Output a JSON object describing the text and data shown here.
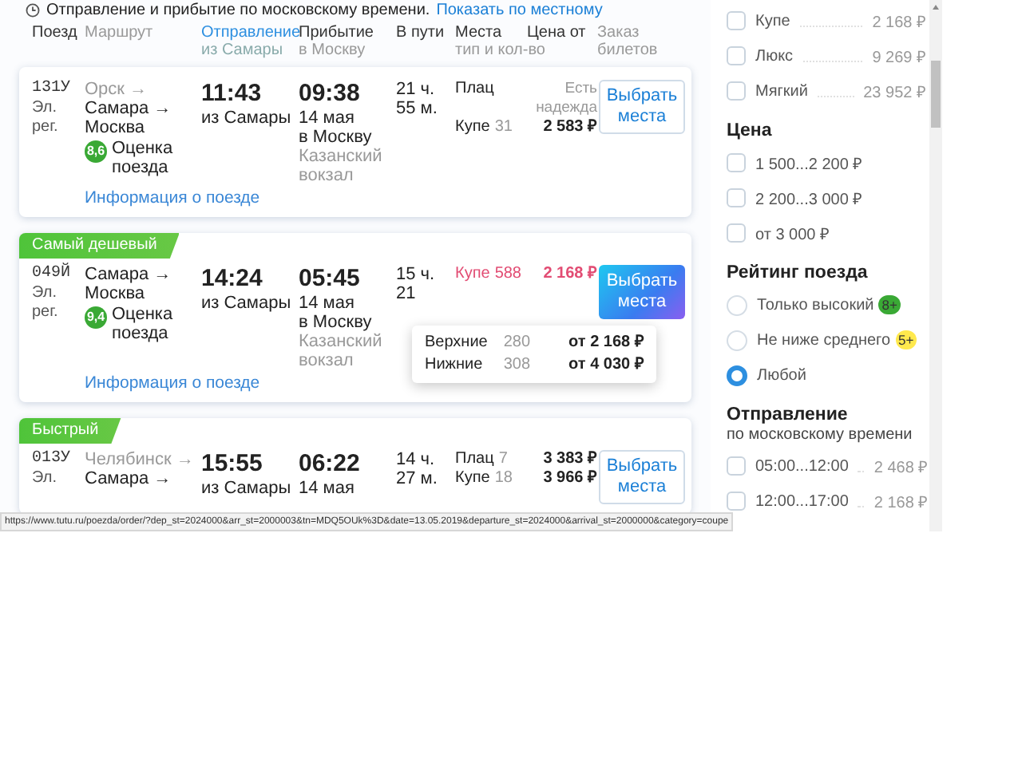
{
  "notice": {
    "text": "Отправление и прибытие по московскому времени.",
    "link": "Показать по местному"
  },
  "columns": [
    {
      "title": "Поезд",
      "kind": "plain"
    },
    {
      "title": "Маршрут",
      "kind": "muted"
    },
    {
      "title": "Отправление",
      "subtitle": "из Самары",
      "kind": "sorted"
    },
    {
      "title": "Прибытие",
      "subtitle": "в Москву",
      "kind": "plain"
    },
    {
      "title": "В пути",
      "kind": "plain"
    },
    {
      "title": "Места",
      "subtitle": "тип и кол-во",
      "kind": "plain"
    },
    {
      "title": "Цена от",
      "kind": "plain"
    },
    {
      "title": "Заказ",
      "subtitle": "билетов",
      "kind": "muted"
    }
  ],
  "trains": [
    {
      "number": "131У",
      "type": [
        "Эл.",
        "рег."
      ],
      "route": [
        {
          "name": "Орск →",
          "muted": true
        },
        {
          "name": "Самара →",
          "muted": false
        },
        {
          "name": "Москва",
          "muted": false
        }
      ],
      "rating": {
        "score": "8,6",
        "label": "Оценка поезда",
        "color": "#3aa935"
      },
      "info_link": "Информация о поезде",
      "departure": {
        "time": "11:43",
        "note": "из Самары"
      },
      "arrival": {
        "time": "09:38",
        "date": "14 мая",
        "city": "в Москву",
        "station": "Казанский вокзал"
      },
      "duration": [
        "21 ч.",
        "55 м."
      ],
      "seats": [
        {
          "type": "Плац",
          "note": "Есть надежда",
          "hovered": false
        },
        {
          "type": "Купе",
          "count": "31",
          "price": "2 583 ₽",
          "hovered": false
        }
      ],
      "button": {
        "label": "Выбрать места",
        "hovered": false
      }
    },
    {
      "tag": "Самый дешевый",
      "number": "049Й",
      "type": [
        "Эл.",
        "рег."
      ],
      "route": [
        {
          "name": "Самара →",
          "muted": false
        },
        {
          "name": "Москва",
          "muted": false
        }
      ],
      "rating": {
        "score": "9,4",
        "label": "Оценка поезда",
        "color": "#3aa935"
      },
      "info_link": "Информация о поезде",
      "departure": {
        "time": "14:24",
        "note": "из Самары"
      },
      "arrival": {
        "time": "05:45",
        "date": "14 мая",
        "city": "в Москву",
        "station": "Казанский вокзал"
      },
      "duration": [
        "15 ч.",
        "21"
      ],
      "seats": [
        {
          "type": "Купе",
          "count": "588",
          "price": "2 168 ₽",
          "hovered": true
        }
      ],
      "button": {
        "label": "Выбрать места",
        "hovered": true
      },
      "popup": [
        {
          "berth": "Верхние",
          "count": "280",
          "price": "от 2 168 ₽"
        },
        {
          "berth": "Нижние",
          "count": "308",
          "price": "от 4 030 ₽"
        }
      ]
    },
    {
      "tag": "Быстрый",
      "number": "013У",
      "type": [
        "Эл."
      ],
      "route": [
        {
          "name": "Челябинск →",
          "muted": true
        },
        {
          "name": "Самара →",
          "muted": false
        }
      ],
      "departure": {
        "time": "15:55",
        "note": "из Самары"
      },
      "arrival": {
        "time": "06:22",
        "date": "14 мая"
      },
      "duration": [
        "14 ч.",
        "27 м."
      ],
      "seats": [
        {
          "type": "Плац",
          "count": "7",
          "price": "3 383 ₽",
          "hovered": false
        },
        {
          "type": "Купе",
          "count": "18",
          "price": "3 966 ₽",
          "hovered": false
        }
      ],
      "button": {
        "label": "Выбрать места",
        "hovered": false
      }
    }
  ],
  "filters": [
    {
      "kind": "checkbox",
      "items": [
        {
          "label": "Купе",
          "price": "2 168 ₽",
          "checked": false
        },
        {
          "label": "Люкс",
          "price": "9 269 ₽",
          "checked": false
        },
        {
          "label": "Мягкий",
          "price": "23 952 ₽",
          "checked": false
        }
      ]
    },
    {
      "kind": "checkbox",
      "title": "Цена",
      "items": [
        {
          "label": "1 500...2 200 ₽",
          "checked": false
        },
        {
          "label": "2 200...3 000 ₽",
          "checked": false
        },
        {
          "label": "от 3 000 ₽",
          "checked": false
        }
      ]
    },
    {
      "kind": "radio",
      "title": "Рейтинг поезда",
      "items": [
        {
          "label": "Только высокий",
          "badge": "8+",
          "color": "#3aa935",
          "selected": false
        },
        {
          "label": "Не ниже среднего",
          "badge": "5+",
          "color": "#ffe94d",
          "selected": false
        },
        {
          "label": "Любой",
          "selected": true
        }
      ]
    },
    {
      "kind": "checkbox",
      "title": "Отправление",
      "subtitle": "по московскому времени",
      "items": [
        {
          "label": "05:00...12:00",
          "price": "2 468 ₽",
          "checked": false
        },
        {
          "label": "12:00...17:00",
          "price": "2 168 ₽",
          "checked": false
        }
      ]
    }
  ],
  "status_url": "https://www.tutu.ru/poezda/order/?dep_st=2024000&arr_st=2000003&tn=MDQ5OUk%3D&date=13.05.2019&departure_st=2024000&arrival_st=2000000&category=coupe"
}
